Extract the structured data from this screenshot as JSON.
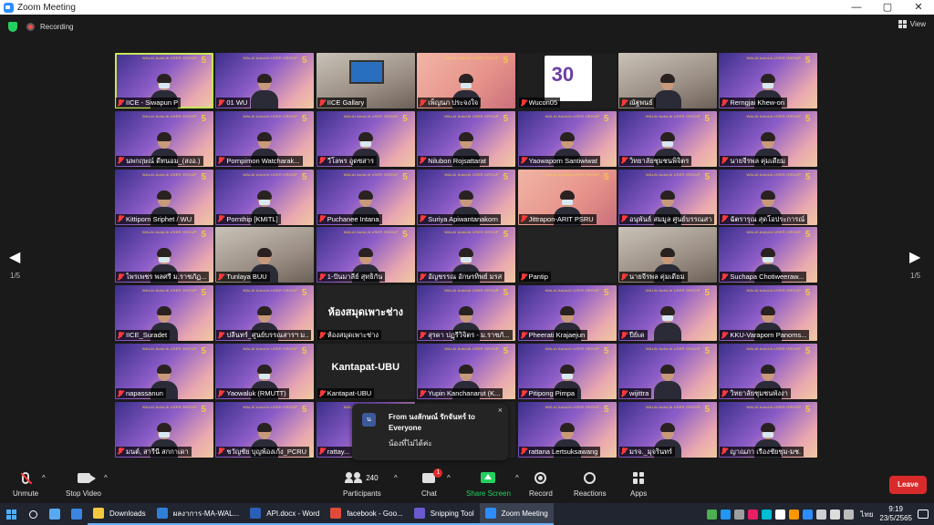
{
  "window": {
    "title": "Zoom Meeting",
    "controls": [
      "—",
      "▢",
      "✕"
    ]
  },
  "topbar": {
    "recording_label": "Recording",
    "view_label": "View"
  },
  "tile_banner": "WALAI AutoLib USER GROUP",
  "tile_banner_number": "5",
  "special_tiles": {
    "library_text": "ห้องสมุดเพาะช่าง",
    "kantapat_text": "Kantapat-UBU",
    "logo_text": "30"
  },
  "participants": [
    "IICE - Siwapun P",
    "01 WU",
    "IICE Gallary",
    "เพ็ญนภ ประจงใจ",
    "Wucon05",
    "ณัฐพนธ์",
    "Rerngjai Khew-on",
    "นพกฤษณ์ ดีทนอม_(สงอ.)",
    "Pornpimon Watcharak...",
    "วีโลพร อูดซสาร",
    "Nilubon Rojsattarat",
    "Yaowaporn Santiwiwat",
    "วิทยาลัยชุมชนพิจิตร",
    "นายจีรพล คุ่มเดียม",
    "Kittiporn Sriphet / WU",
    "Pornthip [KMITL]",
    "Puchanee Intana",
    "Suriya Apiwantanakorn",
    "Jittrapon-ARIT PSRU",
    "อนุพันธ์ สมมูล ศูนย์บรรณสารฯ",
    "ฉัตรารุณ สุดโอประการณ์",
    "ไพรเพชร พลศรี ม.ราชภัฏ...",
    "Tunlaya BUU",
    "1-ปันมาลีย์ สุทธิกัน",
    "อัญชรรณ อักษรทิพย์ มรส",
    "Pantip",
    "นายจีรพล คุ่มเดียม",
    "Suchapa Chotiweeraw...",
    "IICE_Suradet",
    "ปลีนทร์_ศูนย์บรรณสารฯ ม...",
    "ห้องสมุดเพาะช่าง",
    "สุรดา ปฏุรีวิจิตร - ม.ราชภั...",
    "Pheerati Krajaejun",
    "ปีย์เด",
    "KKU-Varaporn Panoms...",
    "napassanun",
    "Yaowaluk (RMUTT)",
    "Kantapat-UBU",
    "Yupin Kanchanarut (K...",
    "Pitipong Pimpa",
    "wijittra",
    "วิทยาลัยชุมชนพังงา",
    "มนต์, สารีนี สกกาเดา",
    "ชวัญชัย บุญพ้องเก้ง_PCRU",
    "rattay...",
    "",
    "rattana Lertsuksawang",
    "มรจ._มุจรินทร์",
    "ญาณภา เรืองชัยชุม-มช."
  ],
  "pagination": {
    "left": "1/5",
    "right": "1/5"
  },
  "chat_popup": {
    "avatar": "น",
    "from": "From นงลักษณ์ รักจันทร์ to Everyone",
    "message": "น้องที่ไม่ได้ค่ะ",
    "close": "×"
  },
  "toolbar": {
    "unmute": "Unmute",
    "stop_video": "Stop Video",
    "participants": "Participants",
    "participants_count": "240",
    "chat": "Chat",
    "chat_badge": "1",
    "share_screen": "Share Screen",
    "record": "Record",
    "reactions": "Reactions",
    "apps": "Apps",
    "leave": "Leave"
  },
  "taskbar": {
    "tasks": [
      {
        "label": "Downloads",
        "color": "#f3c93e"
      },
      {
        "label": "ผลงาการ-MA-WAL...",
        "color": "#2f7ed8"
      },
      {
        "label": "API.docx - Word",
        "color": "#2b5fb5"
      },
      {
        "label": "facebook - Goo...",
        "color": "#e04a3a"
      },
      {
        "label": "Snipping Tool",
        "color": "#6a5acd"
      },
      {
        "label": "Zoom Meeting",
        "color": "#2d8cff"
      }
    ],
    "language": "ไทย",
    "time": "9:19",
    "date": "23/5/2565"
  },
  "colors": {
    "accent": "#2d8cff",
    "leave": "#d92b2b",
    "share": "#23d05e",
    "active_speaker": "#c6e65a",
    "muted_mic": "#ff3a3a"
  }
}
